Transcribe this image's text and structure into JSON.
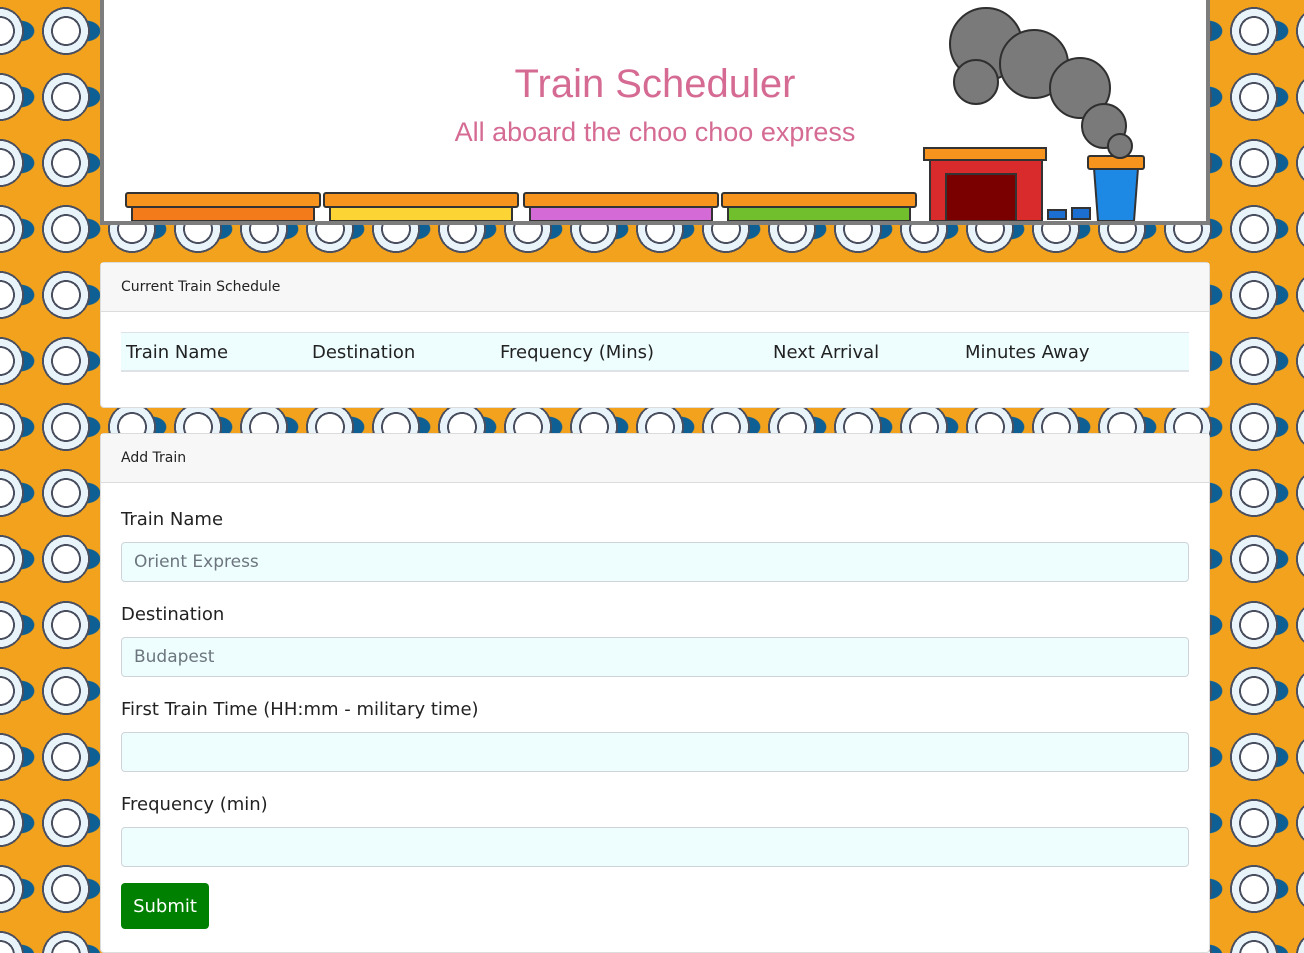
{
  "header": {
    "title": "Train Scheduler",
    "subtitle": "All aboard the choo choo express"
  },
  "schedule": {
    "heading": "Current Train Schedule",
    "columns": [
      "Train Name",
      "Destination",
      "Frequency (Mins)",
      "Next Arrival",
      "Minutes Away"
    ]
  },
  "form": {
    "heading": "Add Train",
    "train_name": {
      "label": "Train Name",
      "placeholder": "Orient Express",
      "value": ""
    },
    "destination": {
      "label": "Destination",
      "placeholder": "Budapest",
      "value": ""
    },
    "first_time": {
      "label": "First Train Time (HH:mm - military time)",
      "placeholder": "",
      "value": ""
    },
    "frequency": {
      "label": "Frequency (min)",
      "placeholder": "",
      "value": ""
    },
    "submit_label": "Submit"
  },
  "colors": {
    "title": "#d56b93",
    "submit": "#008000",
    "background": "#9ad8f4",
    "input_bg": "#eefeff"
  },
  "icons": [
    "train-illustration",
    "steam-cloud-icon",
    "train-wheel-icon",
    "conductor-hat-icon",
    "ticket-icon",
    "locomotive-icon"
  ]
}
